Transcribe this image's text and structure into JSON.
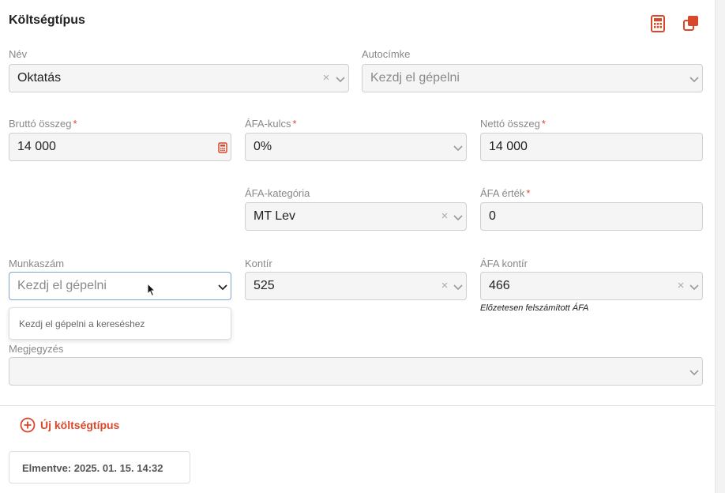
{
  "header": {
    "title": "Költségtípus",
    "calculator_icon": "calculator-icon",
    "copy_icon": "copy-icon",
    "accent": "#d9482b"
  },
  "form": {
    "nev": {
      "label": "Név",
      "value": "Oktatás"
    },
    "autocimke": {
      "label": "Autocímke",
      "placeholder": "Kezdj el gépelni"
    },
    "brutto": {
      "label": "Bruttó összeg",
      "required": "*",
      "value": "14 000"
    },
    "afa_kulcs": {
      "label": "ÁFA-kulcs",
      "required": "*",
      "value": "0%"
    },
    "netto": {
      "label": "Nettó összeg",
      "required": "*",
      "value": "14 000"
    },
    "afa_kategoria": {
      "label": "ÁFA-kategória",
      "value": "MT Lev"
    },
    "afa_ertek": {
      "label": "ÁFA érték",
      "required": "*",
      "value": "0"
    },
    "munkaszam": {
      "label": "Munkaszám",
      "placeholder": "Kezdj el gépelni",
      "dropdown_hint": "Kezdj el gépelni a kereséshez"
    },
    "kontir": {
      "label": "Kontír",
      "value": "525"
    },
    "afa_kontir": {
      "label": "ÁFA kontír",
      "value": "466",
      "help": "Előzetesen felszámított ÁFA"
    },
    "megjegyzes": {
      "label": "Megjegyzés",
      "value": ""
    }
  },
  "actions": {
    "add_label": "Új költségtípus",
    "saved_label": "Elmentve: 2025. 01. 15. 14:32"
  },
  "clear_glyph": "×"
}
